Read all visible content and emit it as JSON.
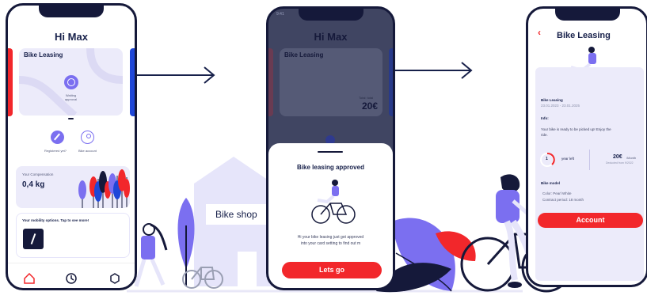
{
  "phone1": {
    "greeting": "Hi Max",
    "leasing_card": {
      "title": "Bike Leasing",
      "status_line1": "Waiting",
      "status_line2": "approval"
    },
    "actions": [
      {
        "label": "Registered yet?",
        "icon": "pencil-icon"
      },
      {
        "label": "Bike account",
        "icon": "user-icon"
      }
    ],
    "compensation": {
      "label": "Your Compensation",
      "value": "0,4 kg"
    },
    "mobility": {
      "title": "Your mobility options. Tap to see more!"
    },
    "nav": [
      {
        "icon": "home-icon"
      },
      {
        "icon": "clock-icon"
      },
      {
        "icon": "settings-icon"
      }
    ]
  },
  "phone2": {
    "status_time": "9:41",
    "greeting": "Hi Max",
    "card_title": "Bike Leasing",
    "price_label": "Total: total",
    "price": "20€",
    "sheet": {
      "title": "Bike leasing approved",
      "body_line1": "Hi your bike leasing just got approved",
      "body_line2": "into your card setting to find out m",
      "button": "Lets go"
    }
  },
  "phone3": {
    "title": "Bike Leasing",
    "section_title": "Bike Leasing",
    "dates": "23.01.2023 - 23.01.2025",
    "info_label": "Info:",
    "info_line1": "Your bike is ready to be picked up! Enjoy the",
    "info_line2": "ride.",
    "years_number": "1",
    "years_label": "year left",
    "price": "20€",
    "price_unit": "/Month",
    "price_sub": "Deducted from 9/2022",
    "model_label": "Bike model",
    "color_line": "Color: Pearl White",
    "contract_line": "Contract period: 18 month",
    "button": "Account"
  },
  "scene": {
    "shop_sign": "Bike shop"
  },
  "colors": {
    "navy": "#15193a",
    "red": "#f2272b",
    "lavender": "#ecebfa",
    "purple": "#7b6ff0",
    "blue": "#1f47d8"
  }
}
